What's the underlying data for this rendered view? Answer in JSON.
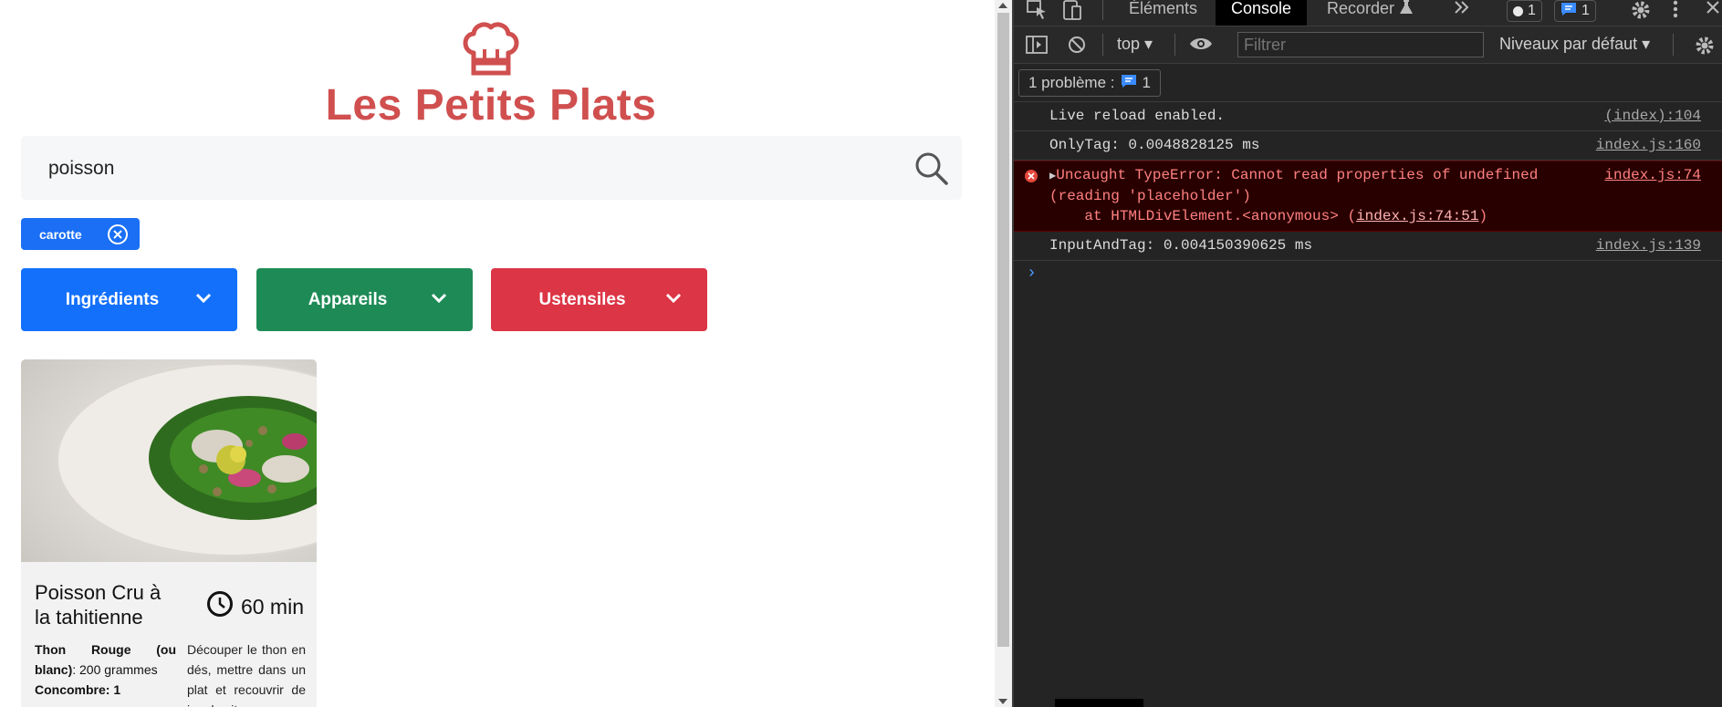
{
  "brand": {
    "title": "Les Petits Plats",
    "color": "#d04f4f"
  },
  "search": {
    "value": "poisson"
  },
  "tags": [
    {
      "label": "carotte",
      "color": "#1a6ff5"
    }
  ],
  "filters": [
    {
      "label": "Ingrédients",
      "color": "#1370fb"
    },
    {
      "label": "Appareils",
      "color": "#1e8b56"
    },
    {
      "label": "Ustensiles",
      "color": "#dc3546"
    }
  ],
  "recipe": {
    "title": "Poisson Cru à la tahitienne",
    "time": "60 min",
    "ingredient_name": "Thon Rouge (ou blanc)",
    "ingredient_qty": ": 200 grammes",
    "ingredient_next": "Concombre: 1",
    "description": "Découper le thon en dés, mettre dans un plat et recouvrir de jus de citron"
  },
  "devtools": {
    "tabs": {
      "elements": "Éléments",
      "console": "Console",
      "recorder": "Recorder"
    },
    "badge_issues": "1",
    "badge_messages": "1",
    "context": "top",
    "filter_placeholder": "Filtrer",
    "levels": "Niveaux par défaut",
    "problems_label": "1 problème :",
    "problems_count": "1",
    "messages": [
      {
        "text": "Live reload enabled.",
        "source": "(index):104"
      },
      {
        "text": "OnlyTag: 0.0048828125 ms",
        "source": "index.js:160"
      },
      {
        "text": "Uncaught TypeError: Cannot read properties of undefined (reading 'placeholder')",
        "detail_prefix": "    at HTMLDivElement.<anonymous> (",
        "detail_link": "index.js:74:51",
        "detail_suffix": ")",
        "source": "index.js:74"
      },
      {
        "text": "InputAndTag: 0.004150390625 ms",
        "source": "index.js:139"
      }
    ]
  }
}
